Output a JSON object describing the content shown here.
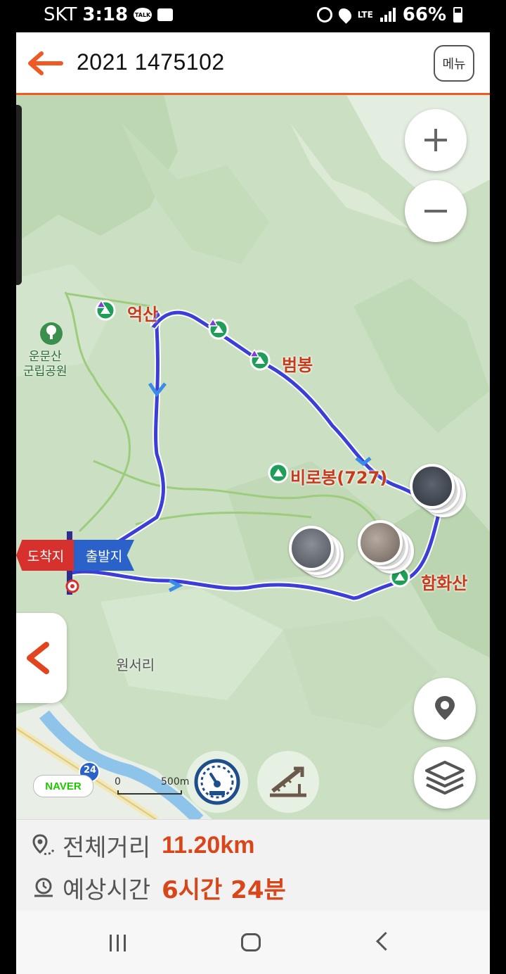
{
  "status_bar": {
    "carrier": "SKT",
    "time": "3:18",
    "talk_badge": "TALK",
    "network": "LTE",
    "battery": "66%"
  },
  "header": {
    "title": "2021 1475102",
    "menu_label": "메뉴"
  },
  "map": {
    "labels": {
      "eoksan": "억산",
      "beombong": "범봉",
      "birobong": "비로봉(727)",
      "hamhwasan": "함화산",
      "wonseori": "원서리",
      "park": "운문산\n군립공원"
    },
    "flags": {
      "arrival": "도착지",
      "departure": "출발지"
    },
    "road_number": "24",
    "naver_logo": "NAVER",
    "scale": {
      "start": "0",
      "end": "500m"
    }
  },
  "info": {
    "distance_label": "전체거리",
    "distance_value": "11.20km",
    "time_label": "예상시간",
    "time_value": "6시간 24분"
  },
  "icons": {
    "back": "arrow-left-icon",
    "zoom_in": "plus-icon",
    "zoom_out": "minus-icon",
    "location": "location-pin-icon",
    "layers": "layers-icon",
    "gauge": "speedometer-icon",
    "slope": "elevation-icon",
    "collapse": "chevron-left-icon"
  },
  "colors": {
    "accent": "#ef5a24",
    "route": "#3b3fd8",
    "value_text": "#d9461a"
  }
}
